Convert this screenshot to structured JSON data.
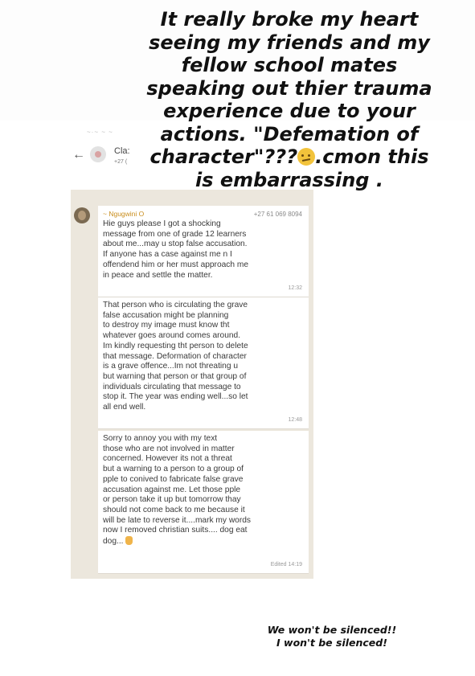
{
  "caption": {
    "line1": "It really broke my heart",
    "line2": "seeing my friends and my",
    "line3": "fellow school mates",
    "line4": "speaking out thier trauma",
    "line5": "experience due to your",
    "line6": "actions. \"Defemation of",
    "line7_before": "character\"???",
    "line7_after": ".cmon this",
    "line8": "is embarrassing  ."
  },
  "chat_header": {
    "group_name": "Cla:",
    "group_sub": "+27 (",
    "status_glyphs": "~·~ ~ ~"
  },
  "messages": [
    {
      "sender_name": "~ Ngugwini O",
      "sender_phone": "+27 61 069 8094",
      "text": "Hie guys please I got a shocking\nmessage from one of grade 12 learners\nabout me...may u stop false accusation.\nIf anyone has a case against me n I\noffendend him or her must approach me\nin peace and settle the matter.",
      "time": "12:32"
    },
    {
      "text": "That person who is circulating the grave\nfalse accusation might be planning\nto destroy my image must know tht\nwhatever goes around comes around.\nIm kindly requesting tht person to delete\nthat message. Deformation of character\nis a grave offence...Im not threating u\nbut warning that person or that group of\nindividuals circulating that message to\nstop it. The year was ending well...so let\nall end well.",
      "time": "12:48"
    },
    {
      "text": "Sorry to annoy you with my text\nthose who are not involved in matter\nconcerned. However its not a threat\nbut a warning to a person to a group of\npple to conived to fabricate false grave\naccusation against me. Let those pple\nor person take it up but tomorrow thay\nshould not come back to me because it\nwill be late to reverse it....mark my words\nnow I removed christian suits.... dog eat\ndog...",
      "time": "Edited 14:19"
    }
  ],
  "bottom_caption": {
    "line1": "We won't be silenced!!",
    "line2": "I won't be silenced!"
  }
}
